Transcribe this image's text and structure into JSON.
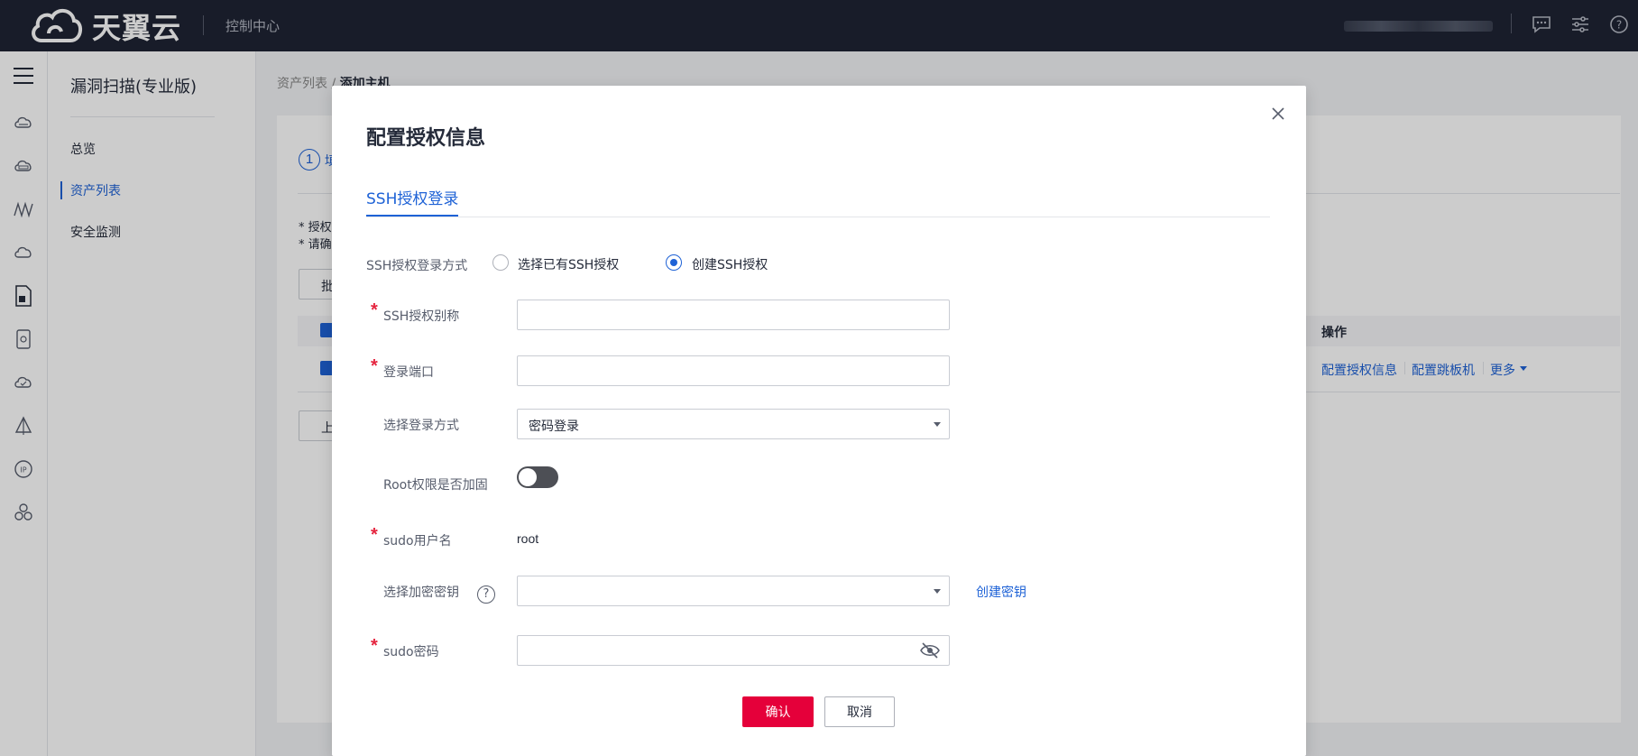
{
  "topbar": {
    "brand": "天翼云",
    "console_label": "控制中心",
    "icons": [
      "message-icon",
      "settings-sliders-icon",
      "help-icon"
    ]
  },
  "rail": {
    "icons": [
      "menu-icon",
      "cloud-server-icon",
      "cloud-hdd-icon",
      "network-icon",
      "cloud-icon",
      "document-icon",
      "storage-icon",
      "cloud-check-icon",
      "triangle-icon",
      "ip-icon",
      "cluster-icon"
    ]
  },
  "sidebar": {
    "title": "漏洞扫描(专业版)",
    "items": [
      {
        "label": "总览",
        "active": false
      },
      {
        "label": "资产列表",
        "active": true
      },
      {
        "label": "安全监测",
        "active": false
      }
    ]
  },
  "background": {
    "breadcrumb_parent": "资产列表",
    "breadcrumb_sep": "/",
    "breadcrumb_current": "添加主机",
    "step_number": "1",
    "step_partial": "填",
    "note1": "* 授权",
    "note2": "* 请确",
    "batch_btn_partial": "批",
    "prev_btn_partial": "上",
    "column_action": "操作",
    "row_actions": [
      "配置授权信息",
      "配置跳板机",
      "更多"
    ]
  },
  "modal": {
    "title": "配置授权信息",
    "tab": "SSH授权登录",
    "ssh_mode": {
      "label": "SSH授权登录方式",
      "options": [
        "选择已有SSH授权",
        "创建SSH授权"
      ],
      "selected_index": 1
    },
    "alias": {
      "label": "SSH授权别称",
      "value": "",
      "placeholder": ""
    },
    "port": {
      "label": "登录端口",
      "value": "",
      "placeholder": ""
    },
    "login_method": {
      "label": "选择登录方式",
      "value": "密码登录"
    },
    "root_harden": {
      "label": "Root权限是否加固",
      "enabled": false
    },
    "sudo_user": {
      "label": "sudo用户名",
      "value": "root"
    },
    "encrypt_key": {
      "label": "选择加密密钥",
      "value": "",
      "create_link": "创建密钥"
    },
    "sudo_password": {
      "label": "sudo密码",
      "value": ""
    },
    "confirm_label": "确认",
    "cancel_label": "取消"
  },
  "colors": {
    "primary_blue": "#1e62d6",
    "danger_red": "#e5003a",
    "topbar_bg": "#1f2434"
  }
}
